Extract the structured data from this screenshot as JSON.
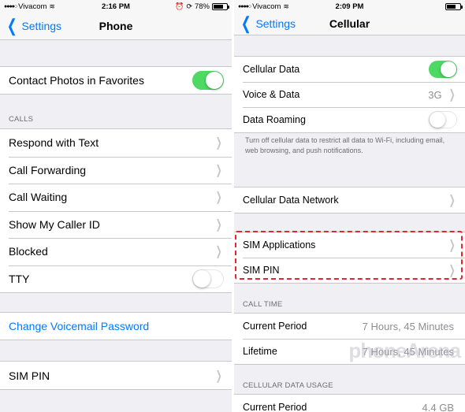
{
  "left": {
    "status": {
      "carrier": "Vivacom",
      "time": "2:16 PM",
      "battery": "78%",
      "battery_level": 0.78
    },
    "nav": {
      "back_label": "Settings",
      "title": "Phone"
    },
    "contact_photos": {
      "label": "Contact Photos in Favorites",
      "on": true
    },
    "calls_header": "CALLS",
    "calls": [
      {
        "label": "Respond with Text"
      },
      {
        "label": "Call Forwarding"
      },
      {
        "label": "Call Waiting"
      },
      {
        "label": "Show My Caller ID"
      },
      {
        "label": "Blocked"
      }
    ],
    "tty": {
      "label": "TTY",
      "on": false
    },
    "voicemail": {
      "label": "Change Voicemail Password"
    },
    "sim_pin": {
      "label": "SIM PIN"
    }
  },
  "right": {
    "status": {
      "carrier": "Vivacom",
      "time": "2:09 PM"
    },
    "nav": {
      "back_label": "Settings",
      "title": "Cellular"
    },
    "cellular_data": {
      "label": "Cellular Data",
      "on": true
    },
    "voice_data": {
      "label": "Voice & Data",
      "value": "3G"
    },
    "data_roaming": {
      "label": "Data Roaming",
      "on": false
    },
    "roaming_note": "Turn off cellular data to restrict all data to Wi-Fi, including email, web browsing, and push notifications.",
    "network": {
      "label": "Cellular Data Network"
    },
    "sim_applications": {
      "label": "SIM Applications"
    },
    "sim_pin": {
      "label": "SIM PIN"
    },
    "call_time_header": "CALL TIME",
    "current_period": {
      "label": "Current Period",
      "value": "7 Hours, 45 Minutes"
    },
    "lifetime": {
      "label": "Lifetime",
      "value": "7 Hours, 45 Minutes"
    },
    "data_usage_header": "CELLULAR DATA USAGE",
    "usage_current_period": {
      "label": "Current Period",
      "value": "4.4 GB"
    }
  },
  "watermark": "phoneArena",
  "colors": {
    "ios_blue": "#007aff",
    "toggle_green": "#4cd964",
    "highlight_red": "#e0262e"
  }
}
